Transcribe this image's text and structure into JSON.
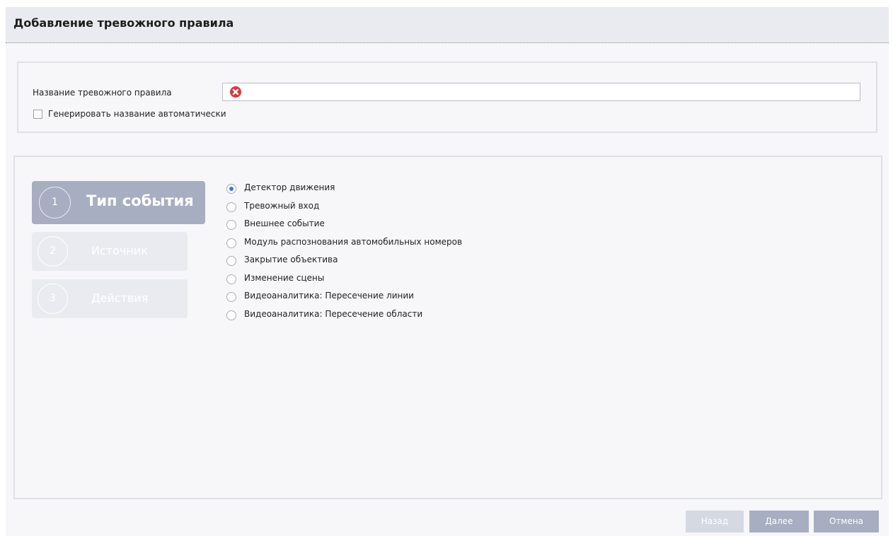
{
  "window": {
    "title": "Добавление тревожного правила"
  },
  "name_panel": {
    "label": "Название тревожного правила",
    "input_value": "",
    "error_icon": "error-x-icon",
    "auto_label": "Генерировать название автоматически",
    "auto_checked": false
  },
  "steps": [
    {
      "number": "1",
      "label": "Тип события",
      "active": true
    },
    {
      "number": "2",
      "label": "Источник",
      "active": false
    },
    {
      "number": "3",
      "label": "Действия",
      "active": false
    }
  ],
  "event_types": {
    "selected": "Детектор движения",
    "options": [
      "Детектор движения",
      "Тревожный вход",
      "Внешнее событие",
      "Модуль распознования автомобильных номеров",
      "Закрытие объектива",
      "Изменение сцены",
      "Видеоаналитика: Пересечение линии",
      "Видеоаналитика: Пересечение области"
    ]
  },
  "buttons": {
    "back": "Назад",
    "next": "Далее",
    "cancel": "Отмена"
  },
  "colors": {
    "accent": "#2f7be6",
    "error": "#d9383a",
    "step_active": "#a7aec1",
    "step_inactive": "#e9ebf0"
  }
}
